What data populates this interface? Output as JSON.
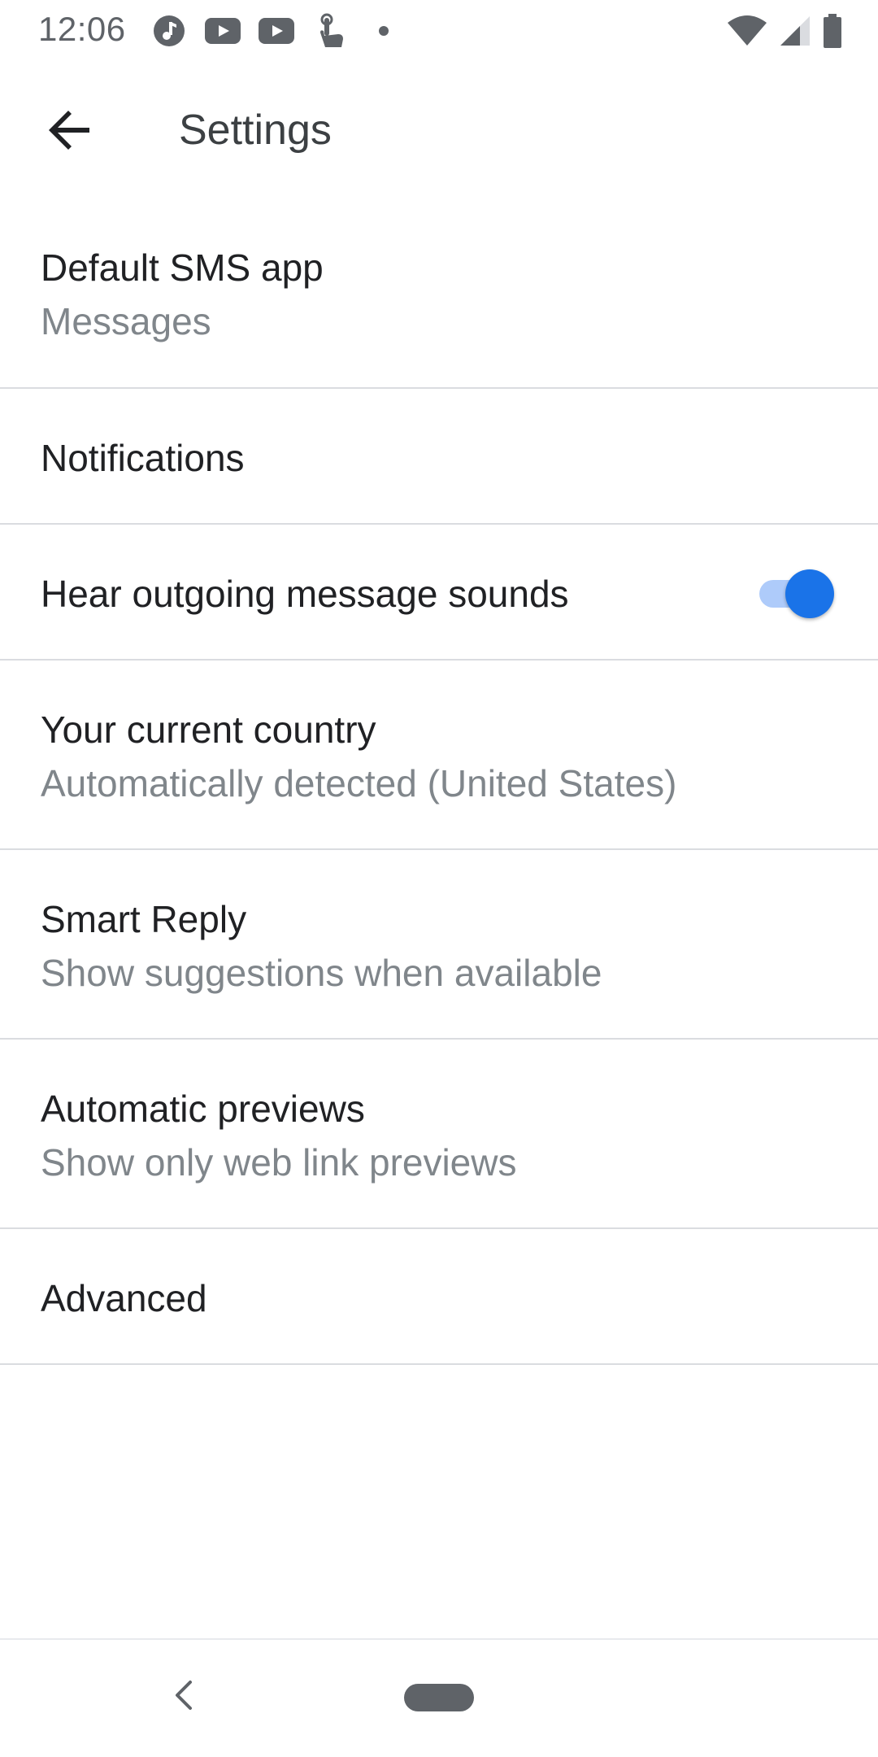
{
  "status_bar": {
    "time": "12:06",
    "left_icons": [
      "music-note-icon",
      "youtube-icon",
      "youtube-icon",
      "touch-icon",
      "dot-icon"
    ],
    "right_icons": [
      "wifi-icon",
      "cellular-signal-icon",
      "battery-icon"
    ]
  },
  "app_bar": {
    "back_icon": "arrow-back-icon",
    "title": "Settings"
  },
  "settings": {
    "default_sms": {
      "title": "Default SMS app",
      "subtitle": "Messages"
    },
    "notifications": {
      "title": "Notifications"
    },
    "outgoing_sounds": {
      "title": "Hear outgoing message sounds",
      "enabled": true
    },
    "current_country": {
      "title": "Your current country",
      "subtitle": "Automatically detected (United States)"
    },
    "smart_reply": {
      "title": "Smart Reply",
      "subtitle": "Show suggestions when available"
    },
    "automatic_previews": {
      "title": "Automatic previews",
      "subtitle": "Show only web link previews"
    },
    "advanced": {
      "title": "Advanced"
    }
  },
  "nav_bar": {
    "back_icon": "nav-back-icon",
    "home_icon": "home-pill-icon"
  },
  "colors": {
    "accent": "#1a73e8",
    "accent_track": "#aecbfa",
    "primary_text": "#202124",
    "secondary_text": "#80868b",
    "divider": "#dadce0"
  }
}
